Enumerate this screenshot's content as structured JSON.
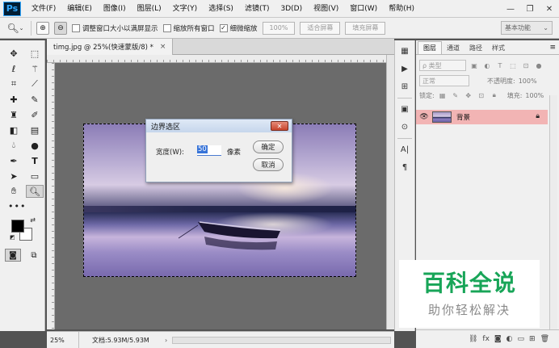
{
  "app": {
    "logo": "Ps"
  },
  "menubar": {
    "items": [
      "文件(F)",
      "编辑(E)",
      "图像(I)",
      "图层(L)",
      "文字(Y)",
      "选择(S)",
      "滤镜(T)",
      "3D(D)",
      "视图(V)",
      "窗口(W)",
      "帮助(H)"
    ]
  },
  "window_controls": {
    "minimize": "—",
    "restore": "❐",
    "close": "✕"
  },
  "options_bar": {
    "resize_windows_label": "调整窗口大小以满屏显示",
    "resize_windows_checked": false,
    "zoom_all_label": "缩放所有窗口",
    "zoom_all_checked": false,
    "scrubby_zoom_label": "细微缩放",
    "scrubby_zoom_checked": true,
    "zoom_percent": "100%",
    "fit_screen": "适合屏幕",
    "fill_screen": "填充屏幕",
    "workspace": "基本功能"
  },
  "document": {
    "tab_title": "timg.jpg @ 25%(快速蒙版/8) *",
    "close_glyph": "×"
  },
  "dialog": {
    "title": "边界选区",
    "width_label": "宽度(W):",
    "width_value": "50",
    "unit": "像素",
    "ok": "确定",
    "cancel": "取消",
    "close_glyph": "✕"
  },
  "statusbar": {
    "zoom": "25%",
    "doc_info": "文档:5.93M/5.93M",
    "arrow": "›"
  },
  "layers_panel": {
    "tabs": [
      "图层",
      "通道",
      "路径",
      "样式"
    ],
    "active_tab": "图层",
    "filter_kind": "ρ 类型",
    "blend_mode": "正常",
    "opacity_label": "不透明度:",
    "opacity_value": "100%",
    "lock_label": "锁定:",
    "fill_label": "填充:",
    "fill_value": "100%",
    "layers": [
      {
        "name": "背景",
        "visible": true,
        "locked": true
      }
    ],
    "bottom_icons": [
      "link-icon",
      "fx-icon",
      "mask-icon",
      "adjustment-icon",
      "group-icon",
      "new-layer-icon",
      "trash-icon"
    ],
    "fx_text": "fx"
  },
  "watermark": {
    "title": "百科全说",
    "subtitle": "助你轻松解决"
  },
  "colors": {
    "selected_layer": "#f2b4b4",
    "watermark_green": "#18a558",
    "canvas_bg": "#6b6b6b"
  }
}
